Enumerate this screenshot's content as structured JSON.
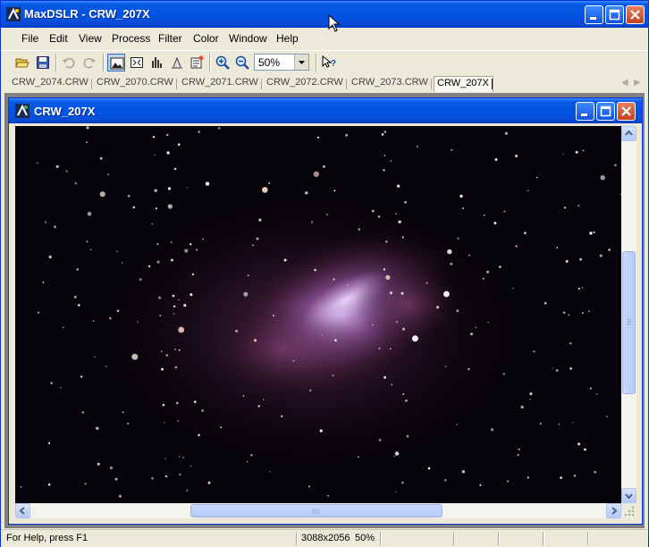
{
  "app": {
    "title": "MaxDSLR - CRW_207X"
  },
  "menu": [
    {
      "label": "File"
    },
    {
      "label": "Edit"
    },
    {
      "label": "View"
    },
    {
      "label": "Process"
    },
    {
      "label": "Filter"
    },
    {
      "label": "Color"
    },
    {
      "label": "Window"
    },
    {
      "label": "Help"
    }
  ],
  "toolbar": {
    "zoom_value": "50%",
    "icons": [
      "open-folder-icon",
      "save-icon",
      "undo-icon",
      "redo-icon",
      "image-view-icon",
      "fit-icon",
      "histogram-icon",
      "levels-icon",
      "properties-icon",
      "zoom-in-icon",
      "zoom-out-icon",
      "context-help-icon"
    ]
  },
  "tabs": [
    {
      "label": "CRW_2074.CRW"
    },
    {
      "label": "CRW_2070.CRW"
    },
    {
      "label": "CRW_2071.CRW"
    },
    {
      "label": "CRW_2072.CRW"
    },
    {
      "label": "CRW_2073.CRW"
    },
    {
      "label": "CRW_207X",
      "active": true
    }
  ],
  "document": {
    "title": "CRW_207X",
    "image": "astrophoto-nebula-starfield"
  },
  "status": {
    "help": "For Help, press F1",
    "dimensions": "3088x2056",
    "zoom": "50%"
  },
  "colors": {
    "titlebar": "#0054e3",
    "close_button": "#c5411e",
    "image_background": "#07030a",
    "nebula": "#b07ab8"
  }
}
